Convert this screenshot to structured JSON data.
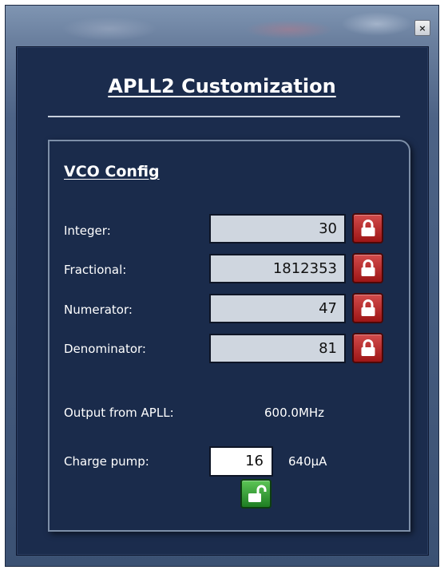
{
  "window": {
    "close_label": "×"
  },
  "dialog": {
    "title": "APLL2 Customization"
  },
  "vco_config": {
    "section_title": "VCO Config",
    "fields": [
      {
        "label": "Integer:",
        "value": "30",
        "locked": true
      },
      {
        "label": "Fractional:",
        "value": "1812353",
        "locked": true
      },
      {
        "label": "Numerator:",
        "value": "47",
        "locked": true
      },
      {
        "label": "Denominator:",
        "value": "81",
        "locked": true
      }
    ],
    "output": {
      "label": "Output from APLL:",
      "value": "600.0MHz"
    },
    "charge_pump": {
      "label": "Charge pump:",
      "value": "16",
      "unit_value": "640µA",
      "locked": false
    }
  },
  "icons": {
    "lock": "lock-icon",
    "unlock": "unlock-icon",
    "close": "close-icon"
  },
  "colors": {
    "dialog_bg": "#1b2c4d",
    "lock_red": "#b72424",
    "unlock_green": "#2e9a2f"
  }
}
